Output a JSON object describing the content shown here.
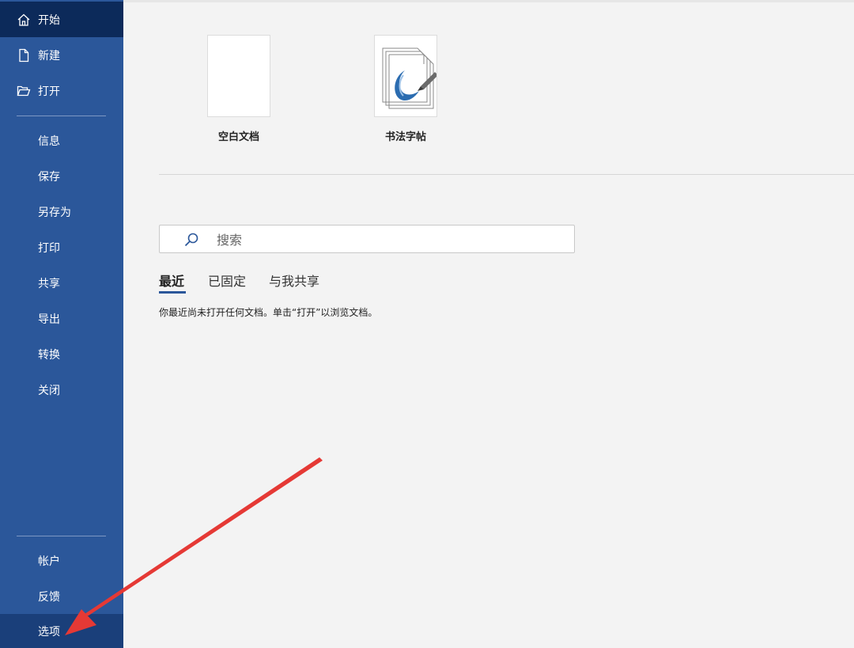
{
  "sidebar": {
    "items": [
      {
        "label": "开始",
        "icon": "home-icon"
      },
      {
        "label": "新建",
        "icon": "new-document-icon"
      },
      {
        "label": "打开",
        "icon": "folder-open-icon"
      },
      {
        "label": "信息"
      },
      {
        "label": "保存"
      },
      {
        "label": "另存为"
      },
      {
        "label": "打印"
      },
      {
        "label": "共享"
      },
      {
        "label": "导出"
      },
      {
        "label": "转换"
      },
      {
        "label": "关闭"
      },
      {
        "label": "帐户"
      },
      {
        "label": "反馈"
      },
      {
        "label": "选项"
      }
    ]
  },
  "templates": [
    {
      "label": "空白文档"
    },
    {
      "label": "书法字帖"
    }
  ],
  "search": {
    "placeholder": "搜索"
  },
  "tabs": [
    {
      "label": "最近"
    },
    {
      "label": "已固定"
    },
    {
      "label": "与我共享"
    }
  ],
  "recent": {
    "empty_message": "你最近尚未打开任何文档。单击“打开”以浏览文档。"
  },
  "colors": {
    "sidebar": "#2b579a",
    "sidebar_active": "#0c2a5a",
    "annotation_arrow": "#e53935"
  }
}
